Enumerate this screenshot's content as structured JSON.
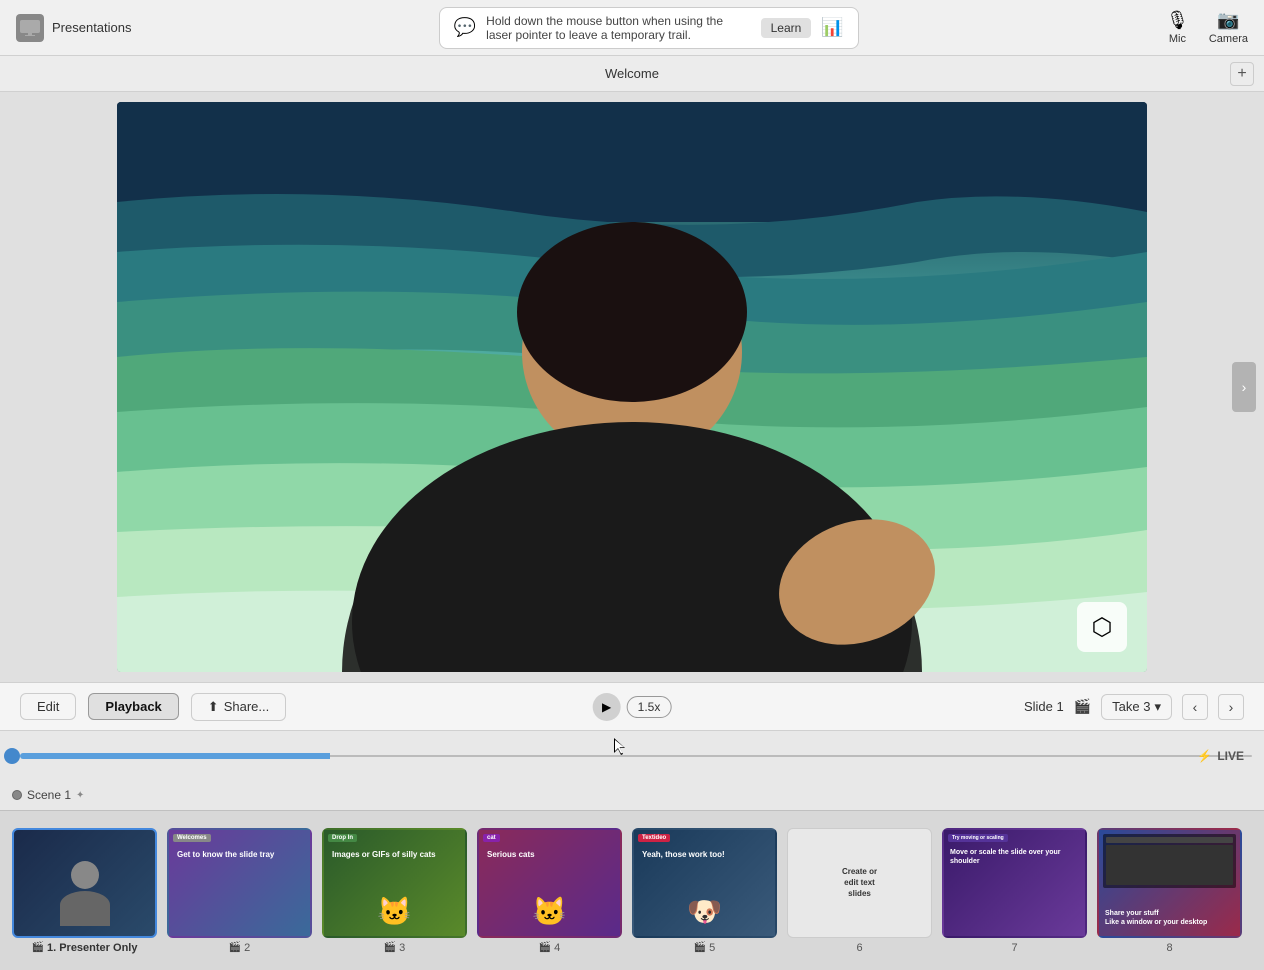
{
  "app": {
    "title": "Presentations",
    "tab_title": "Welcome"
  },
  "topbar": {
    "hint_text": "Hold down the mouse button when using the laser pointer to leave a temporary trail.",
    "learn_label": "Learn",
    "mic_label": "Mic",
    "camera_label": "Camera"
  },
  "tabs": [
    {
      "label": ""
    },
    {
      "label": ""
    },
    {
      "label": ""
    },
    {
      "label": ""
    }
  ],
  "toolbar": {
    "edit_label": "Edit",
    "playback_label": "Playback",
    "share_label": "Share...",
    "play_icon": "▶",
    "speed_label": "1.5x",
    "slide_info": "Slide 1",
    "take_label": "Take 3",
    "prev_icon": "‹",
    "next_icon": "›"
  },
  "timeline": {
    "live_label": "LIVE",
    "lightning": "⚡"
  },
  "scene": {
    "label": "Scene 1",
    "edit_hint": "✦"
  },
  "slides": [
    {
      "num": 1,
      "label": "1. Presenter Only",
      "active": true,
      "has_camera": true,
      "theme": "thumb-1",
      "slide_type": "presenter"
    },
    {
      "num": 2,
      "label": "2",
      "active": false,
      "has_camera": true,
      "theme": "thumb-2",
      "slide_type": "welcome",
      "tag": "",
      "overlay_text": "Get to know the slide tray"
    },
    {
      "num": 3,
      "label": "3",
      "active": false,
      "has_camera": true,
      "theme": "thumb-3",
      "tag": "Drop In",
      "overlay_text": "Images or GIFs of silly cats"
    },
    {
      "num": 4,
      "label": "4",
      "active": false,
      "has_camera": true,
      "theme": "thumb-4",
      "tag": "cat",
      "overlay_text": "Serious cats"
    },
    {
      "num": 5,
      "label": "5",
      "active": false,
      "has_camera": true,
      "theme": "thumb-5",
      "tag": "Textideo",
      "overlay_text": "Yeah, those work too!"
    },
    {
      "num": 6,
      "label": "6",
      "active": false,
      "has_camera": false,
      "theme": "thumb-6",
      "overlay_text": "Create or edit text slides"
    },
    {
      "num": 7,
      "label": "7",
      "active": false,
      "has_camera": false,
      "theme": "thumb-7",
      "overlay_text": "Move or scale the slide over your shoulder"
    },
    {
      "num": 8,
      "label": "8",
      "active": false,
      "has_camera": false,
      "theme": "thumb-8",
      "overlay_text": "Share your stuff Like a window or your desktop"
    }
  ],
  "icons": {
    "presentations": "🖥",
    "mic": "🎙",
    "camera": "📷",
    "chat": "💬",
    "chart": "📊",
    "share": "⬆",
    "cube": "⬡",
    "film": "🎬"
  }
}
